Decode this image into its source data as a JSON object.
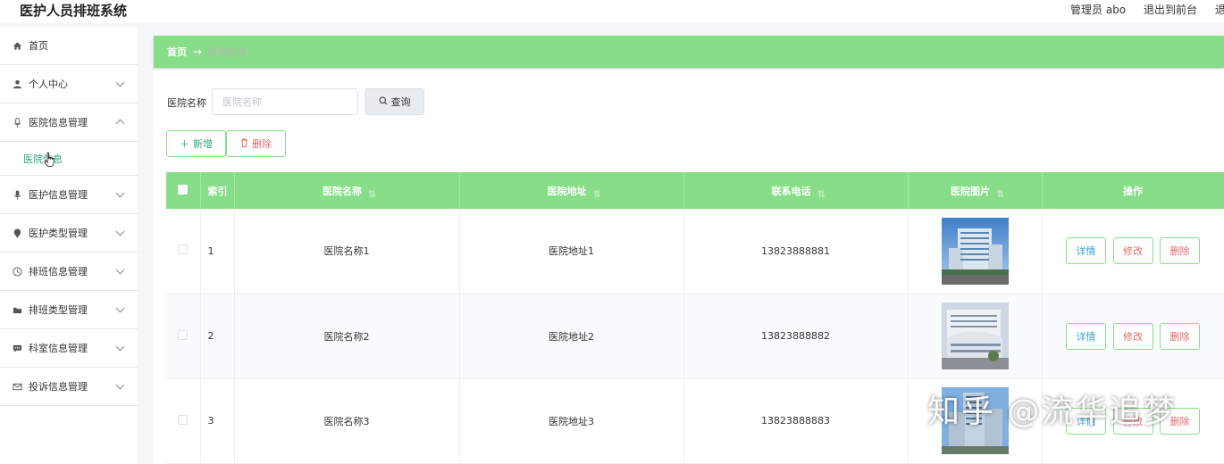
{
  "app": {
    "title": "医护人员排班系统"
  },
  "topbar": {
    "user": "管理员 abo",
    "exit_front": "退出到前台",
    "logout": "退出"
  },
  "sidebar": {
    "items": [
      {
        "label": "首页",
        "icon": "home-icon",
        "expandable": false
      },
      {
        "label": "个人中心",
        "icon": "user-icon",
        "expandable": true
      },
      {
        "label": "医院信息管理",
        "icon": "mic-icon",
        "expandable": true,
        "expanded": true
      },
      {
        "label": "医护信息管理",
        "icon": "mic-icon",
        "expandable": true
      },
      {
        "label": "医护类型管理",
        "icon": "location-icon",
        "expandable": true
      },
      {
        "label": "排班信息管理",
        "icon": "clock-icon",
        "expandable": true
      },
      {
        "label": "排班类型管理",
        "icon": "folder-icon",
        "expandable": true
      },
      {
        "label": "科室信息管理",
        "icon": "message-icon",
        "expandable": true
      },
      {
        "label": "投诉信息管理",
        "icon": "mail-icon",
        "expandable": true
      }
    ],
    "sub_item": "医院信息"
  },
  "breadcrumb": {
    "home": "首页",
    "separator": "→",
    "current": "医院信息"
  },
  "search": {
    "label": "医院名称",
    "placeholder": "医院名称",
    "button": "查询"
  },
  "actions": {
    "add": "新增",
    "delete": "删除"
  },
  "table": {
    "headers": {
      "index": "索引",
      "name": "医院名称",
      "address": "医院地址",
      "phone": "联系电话",
      "image": "医院图片",
      "ops": "操作"
    },
    "rows": [
      {
        "index": "1",
        "name": "医院名称1",
        "address": "医院地址1",
        "phone": "13823888881"
      },
      {
        "index": "2",
        "name": "医院名称2",
        "address": "医院地址2",
        "phone": "13823888882"
      },
      {
        "index": "3",
        "name": "医院名称3",
        "address": "医院地址3",
        "phone": "13823888883"
      }
    ],
    "row_actions": {
      "detail": "详情",
      "edit": "修改",
      "remove": "删除"
    }
  },
  "watermark": "知乎 @流华追梦",
  "colors": {
    "accent": "#88de88",
    "link": "#2aa87a",
    "danger": "#e06c6c",
    "info": "#3aa3c8"
  }
}
